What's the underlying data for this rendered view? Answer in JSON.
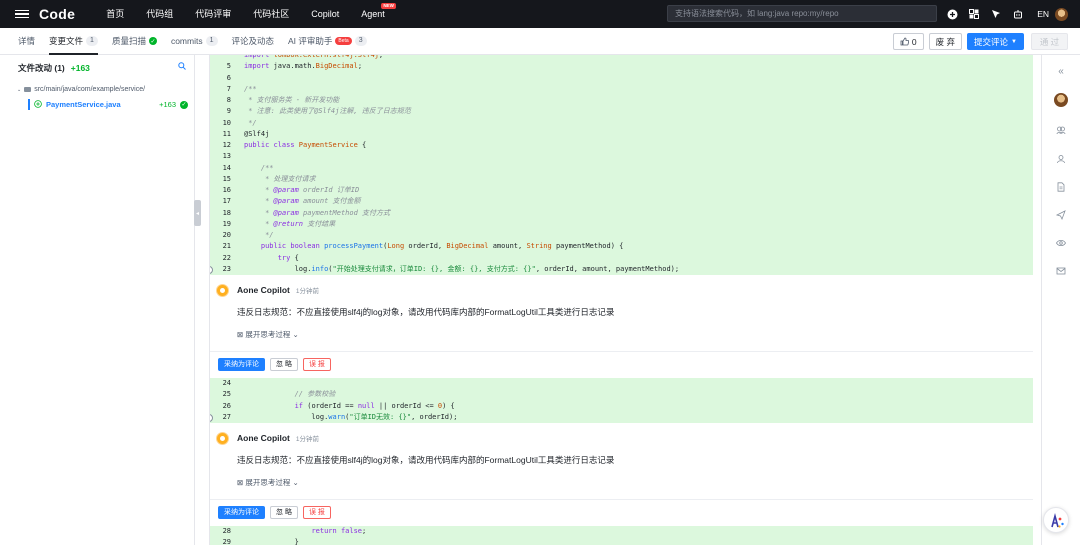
{
  "topbar": {
    "logo": "Code",
    "nav": [
      "首页",
      "代码组",
      "代码评审",
      "代码社区",
      "Copilot",
      "Agent"
    ],
    "agent_badge": "NEW",
    "search_placeholder": "支持语法搜索代码，如 lang:java repo:my/repo",
    "lang": "EN"
  },
  "tabs": {
    "items": [
      {
        "label": "详情"
      },
      {
        "label": "变更文件",
        "count": "1"
      },
      {
        "label": "质量扫描"
      },
      {
        "label": "commits",
        "count": "1"
      },
      {
        "label": "评论及动态"
      },
      {
        "label": "AI 评审助手",
        "badge": "Beta",
        "count": "3"
      }
    ],
    "like_count": "0",
    "abandon": "废 弃",
    "submit_review": "提交评论",
    "approve": "通 过"
  },
  "files": {
    "title": "文件改动 (1)",
    "added": "+163",
    "dir": "src/main/java/com/example/service/",
    "file": "PaymentService.java",
    "file_added": "+163"
  },
  "code_block_1": [
    {
      "n": "5"
    },
    {
      "n": "6"
    },
    {
      "n": "7"
    },
    {
      "n": "8"
    },
    {
      "n": "9"
    },
    {
      "n": "10"
    },
    {
      "n": "11"
    },
    {
      "n": "12"
    },
    {
      "n": "13"
    },
    {
      "n": "14"
    },
    {
      "n": "15"
    },
    {
      "n": "16"
    },
    {
      "n": "17"
    },
    {
      "n": "18"
    },
    {
      "n": "19"
    },
    {
      "n": "20"
    },
    {
      "n": "21"
    },
    {
      "n": "22"
    },
    {
      "n": "23"
    }
  ],
  "code_block_2": [
    {
      "n": "24"
    },
    {
      "n": "25"
    },
    {
      "n": "26"
    },
    {
      "n": "27"
    }
  ],
  "code_block_3": [
    {
      "n": "28"
    },
    {
      "n": "29"
    },
    {
      "n": "30"
    }
  ],
  "comments": [
    {
      "author": "Aone Copilot",
      "time": "1分钟前",
      "body": "违反日志规范：不应直接使用slf4j的log对象，请改用代码库内部的FormatLogUtil工具类进行日志记录",
      "think": "展开思考过程",
      "accept": "采纳为评论",
      "ignore": "忽 略",
      "report": "误 报"
    },
    {
      "author": "Aone Copilot",
      "time": "1分钟前",
      "body": "违反日志规范：不应直接使用slf4j的log对象，请改用代码库内部的FormatLogUtil工具类进行日志记录",
      "think": "展开思考过程",
      "accept": "采纳为评论",
      "ignore": "忽 略",
      "report": "误 报"
    }
  ]
}
